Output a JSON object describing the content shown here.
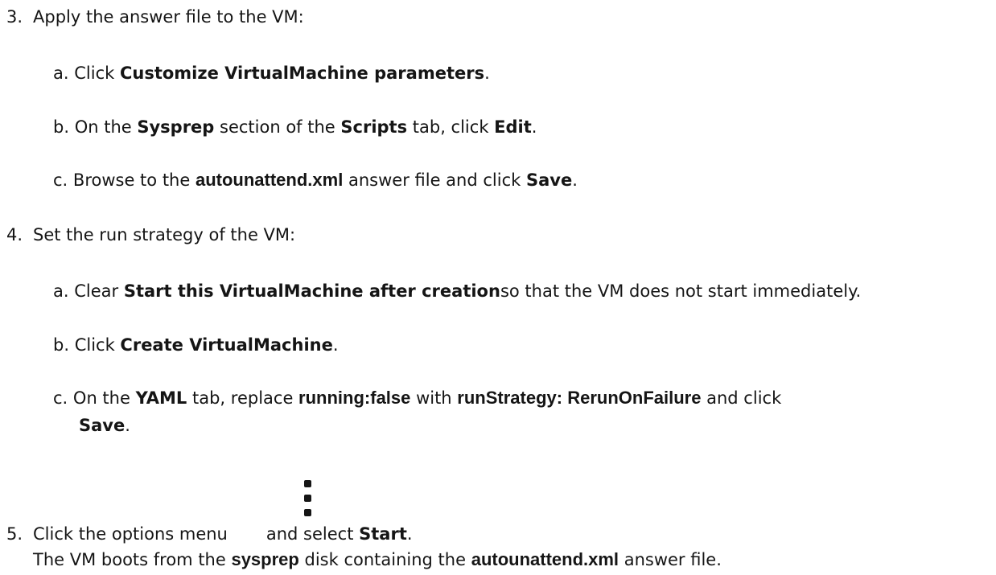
{
  "steps": {
    "step3": {
      "number": "3.",
      "text": "Apply the answer file to the VM:",
      "a": {
        "marker": "a.",
        "pre": "Click ",
        "ui": "Customize VirtualMachine parameters",
        "post": "."
      },
      "b": {
        "marker": "b.",
        "pre": "On the ",
        "ui1": "Sysprep",
        "mid1": " section of the ",
        "ui2": "Scripts",
        "mid2": " tab, click ",
        "ui3": "Edit",
        "post": "."
      },
      "c": {
        "marker": "c.",
        "pre": "Browse to the ",
        "hl": "autounattend.xml",
        "mid": " answer file and click ",
        "ui": "Save",
        "post": "."
      }
    },
    "step4": {
      "number": "4.",
      "text": "Set the run strategy of the VM:",
      "a": {
        "marker": "a.",
        "pre": "Clear ",
        "ui": "Start this VirtualMachine after creation",
        "post": "so that the VM does not start immediately."
      },
      "b": {
        "marker": "b.",
        "pre": "Click ",
        "ui": "Create VirtualMachine",
        "post": "."
      },
      "c": {
        "marker": "c.",
        "pre": "On the ",
        "ui1": "YAML",
        "mid1": " tab, replace ",
        "hl1": "running:false",
        "mid2": " with ",
        "hl2": "runStrategy: RerunOnFailure",
        "post": " and click",
        "ui2": "Save",
        "post2": "."
      }
    },
    "step5": {
      "number": "5.",
      "pre": "Click the options menu",
      "mid": "and select ",
      "ui": "Start",
      "post": ".",
      "note_pre": "The VM boots from the ",
      "note_hl1": "sysprep",
      "note_mid": " disk containing the ",
      "note_hl2": "autounattend.xml",
      "note_post": " answer file."
    }
  },
  "icons": {
    "options_menu": "kebab-icon"
  }
}
